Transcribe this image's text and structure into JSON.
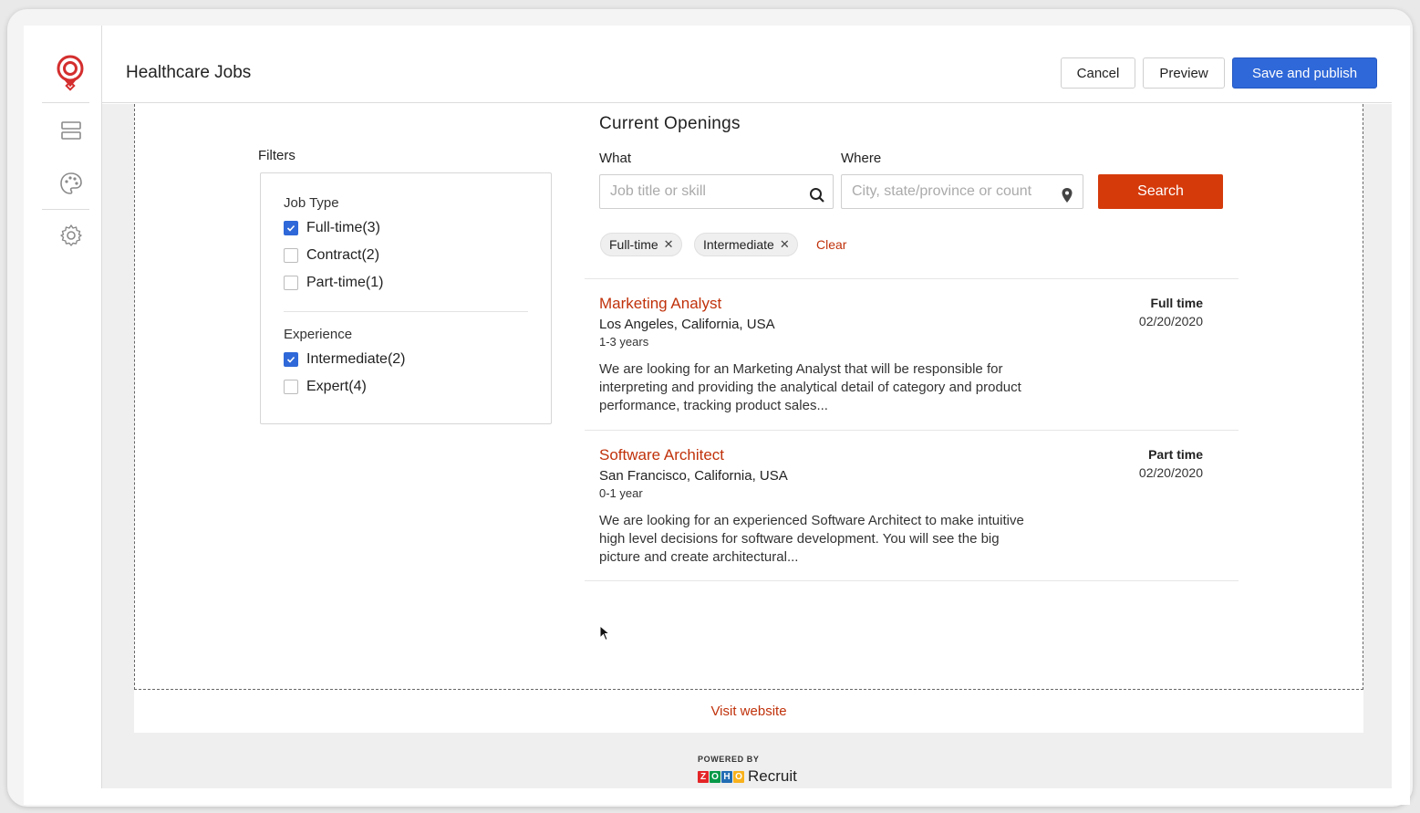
{
  "header": {
    "title": "Healthcare Jobs",
    "cancel_label": "Cancel",
    "preview_label": "Preview",
    "publish_label": "Save and publish"
  },
  "sidebar": {
    "icons": [
      "brand-logo-icon",
      "layout-sections-icon",
      "palette-icon",
      "settings-gear-icon"
    ]
  },
  "filters": {
    "title": "Filters",
    "groups": [
      {
        "title": "Job Type",
        "items": [
          {
            "label": "Full-time(3)",
            "checked": true
          },
          {
            "label": "Contract(2)",
            "checked": false
          },
          {
            "label": "Part-time(1)",
            "checked": false
          }
        ]
      },
      {
        "title": "Experience",
        "items": [
          {
            "label": "Intermediate(2)",
            "checked": true
          },
          {
            "label": "Expert(4)",
            "checked": false
          }
        ]
      }
    ]
  },
  "openings": {
    "title": "Current Openings",
    "what_label": "What",
    "what_placeholder": "Job title or skill",
    "where_label": "Where",
    "where_placeholder": "City, state/province or count",
    "search_label": "Search",
    "chips": [
      "Full-time",
      "Intermediate"
    ],
    "clear_label": "Clear"
  },
  "jobs": [
    {
      "title": "Marketing Analyst",
      "location": "Los Angeles, California, USA",
      "experience": "1-3 years",
      "description": "We are looking for an Marketing Analyst that will be responsible for interpreting and providing the analytical detail of category and product performance, tracking product sales...",
      "type": "Full time",
      "date": "02/20/2020"
    },
    {
      "title": "Software Architect",
      "location": "San Francisco, California, USA",
      "experience": "0-1 year",
      "description": "We are looking for an experienced Software Architect to make intuitive high level decisions for software development. You will see the big picture and create architectural...",
      "type": "Part time",
      "date": "02/20/2020"
    }
  ],
  "footer": {
    "visit_label": "Visit website",
    "powered_by": "POWERED BY",
    "zoho_letters": [
      "Z",
      "O",
      "H",
      "O"
    ],
    "product": "Recruit"
  },
  "colors": {
    "accent_red": "#c0320b",
    "search_red": "#d53a0b",
    "publish_blue": "#2f68d8",
    "zoho": [
      "#e42527",
      "#089949",
      "#226db4",
      "#f9b21d"
    ]
  }
}
